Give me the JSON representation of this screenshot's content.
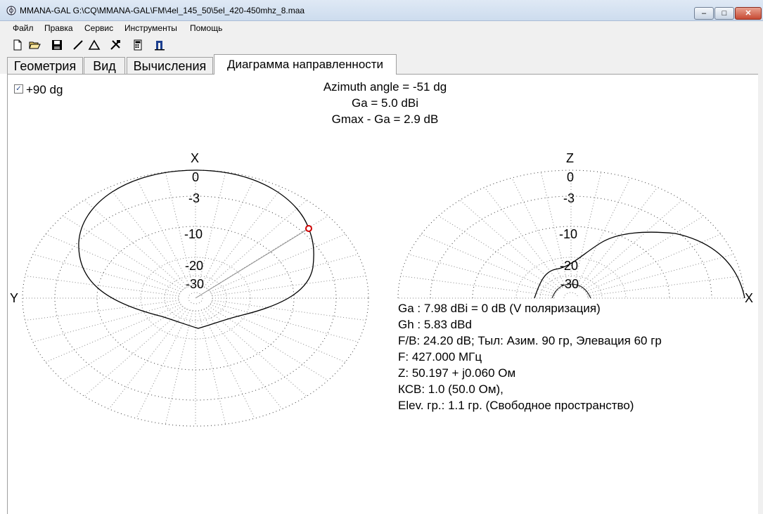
{
  "window": {
    "title": "MMANA-GAL G:\\CQ\\MMANA-GAL\\FM\\4el_145_50\\5el_420-450mhz_8.maa",
    "min_label": "–",
    "max_label": "□",
    "close_label": "✕"
  },
  "menu": [
    "Файл",
    "Правка",
    "Сервис",
    "Инструменты",
    "Помощь"
  ],
  "toolbar_icons": [
    "new-file-icon",
    "open-folder-icon",
    "save-icon",
    "line-icon",
    "triangle-icon",
    "tools-icon",
    "calculator-icon",
    "antenna-icon"
  ],
  "tabs": [
    "Геометрия",
    "Вид",
    "Вычисления",
    "Диаграмма направленности"
  ],
  "active_tab": 3,
  "option": {
    "label": "+90 dg",
    "checked": true,
    "check_mark": "✓"
  },
  "header": {
    "azimuth": "Azimuth angle = -51 dg",
    "ga": "Ga = 5.0 dBi",
    "gmax": "Gmax - Ga = 2.9 dB"
  },
  "horizontal_plot": {
    "axis_top": "X",
    "axis_left": "Y",
    "ring_labels": [
      "0",
      "-3",
      "-10",
      "-20",
      "-30"
    ],
    "marker_color": "#d00000"
  },
  "vertical_plot": {
    "axis_top": "Z",
    "axis_right": "X",
    "ring_labels": [
      "0",
      "-3",
      "-10",
      "-20",
      "-30"
    ]
  },
  "info": [
    "Ga : 7.98 dBi = 0 dB  (V поляризация)",
    "Gh : 5.83 dBd",
    "F/B: 24.20 dB; Тыл: Азим. 90 гр, Элевация 60 гр",
    "F: 427.000 МГц",
    "Z: 50.197 + j0.060 Ом",
    "КСВ: 1.0 (50.0 Ом),",
    "Elev. гр.: 1.1 гр. (Свободное пространство)"
  ]
}
